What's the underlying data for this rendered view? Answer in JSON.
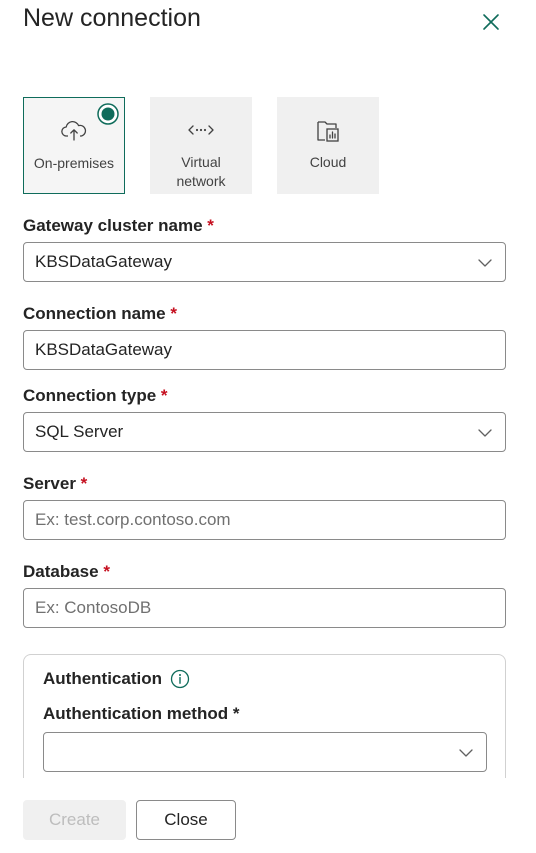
{
  "dialog": {
    "title": "New connection",
    "close_icon": "close-icon"
  },
  "tiles": [
    {
      "label": "On-premises",
      "icon": "cloud-upload-icon",
      "selected": true
    },
    {
      "label_line1": "Virtual",
      "label_line2": "network",
      "icon": "network-arrows-icon",
      "selected": false
    },
    {
      "label": "Cloud",
      "icon": "cloud-report-icon",
      "selected": false
    }
  ],
  "form": {
    "required_marker": "*",
    "gateway": {
      "label": "Gateway cluster name",
      "value": "KBSDataGateway"
    },
    "connection_name": {
      "label": "Connection name",
      "value": "KBSDataGateway"
    },
    "connection_type": {
      "label": "Connection type",
      "value": "SQL Server"
    },
    "server": {
      "label": "Server",
      "placeholder": "Ex: test.corp.contoso.com"
    },
    "database": {
      "label": "Database",
      "placeholder": "Ex: ContosoDB"
    },
    "authentication": {
      "title": "Authentication",
      "method_label": "Authentication method",
      "method_value": ""
    }
  },
  "footer": {
    "create_label": "Create",
    "close_label": "Close"
  },
  "colors": {
    "accent": "#0f6c5b",
    "required": "#c50f1f",
    "border": "#8a8a8a"
  }
}
